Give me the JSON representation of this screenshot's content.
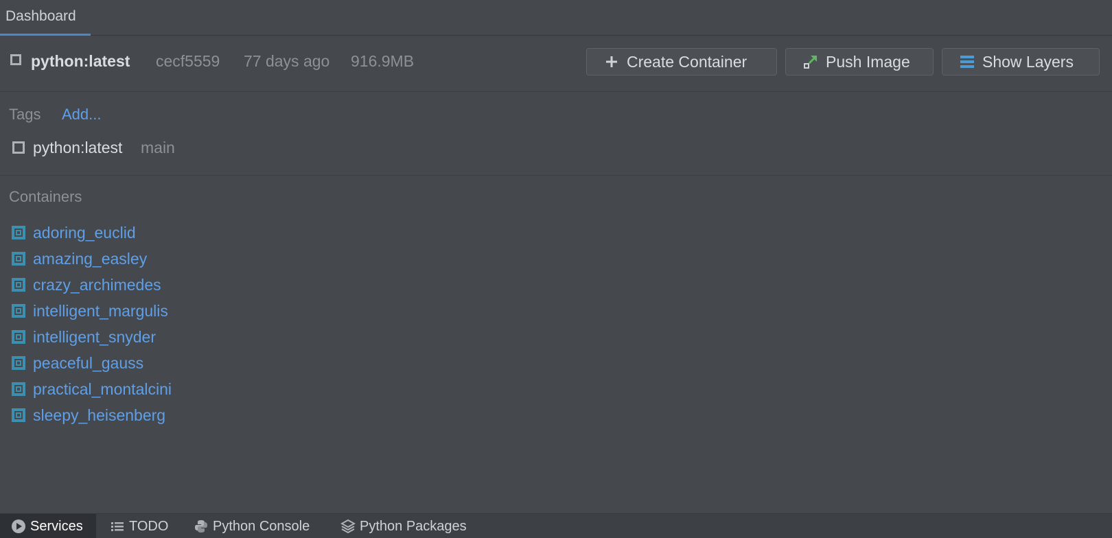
{
  "top_tabs": {
    "dashboard": "Dashboard"
  },
  "image": {
    "name": "python:latest",
    "hash": "cecf5559",
    "age": "77 days ago",
    "size": "916.9MB"
  },
  "toolbar": {
    "create_container": "Create Container",
    "push_image": "Push Image",
    "show_layers": "Show Layers"
  },
  "tags": {
    "label": "Tags",
    "add_link": "Add...",
    "items": [
      {
        "name": "python:latest",
        "branch": "main"
      }
    ]
  },
  "containers": {
    "label": "Containers",
    "items": [
      "adoring_euclid",
      "amazing_easley",
      "crazy_archimedes",
      "intelligent_margulis",
      "intelligent_snyder",
      "peaceful_gauss",
      "practical_montalcini",
      "sleepy_heisenberg"
    ]
  },
  "bottom_bar": {
    "services": "Services",
    "todo": "TODO",
    "python_console": "Python Console",
    "python_packages": "Python Packages"
  },
  "colors": {
    "background": "#45494d",
    "link": "#5f9fe8",
    "accent": "#4a88c7",
    "container_icon": "#3d8fb0",
    "push_arrow": "#5fb85f"
  }
}
